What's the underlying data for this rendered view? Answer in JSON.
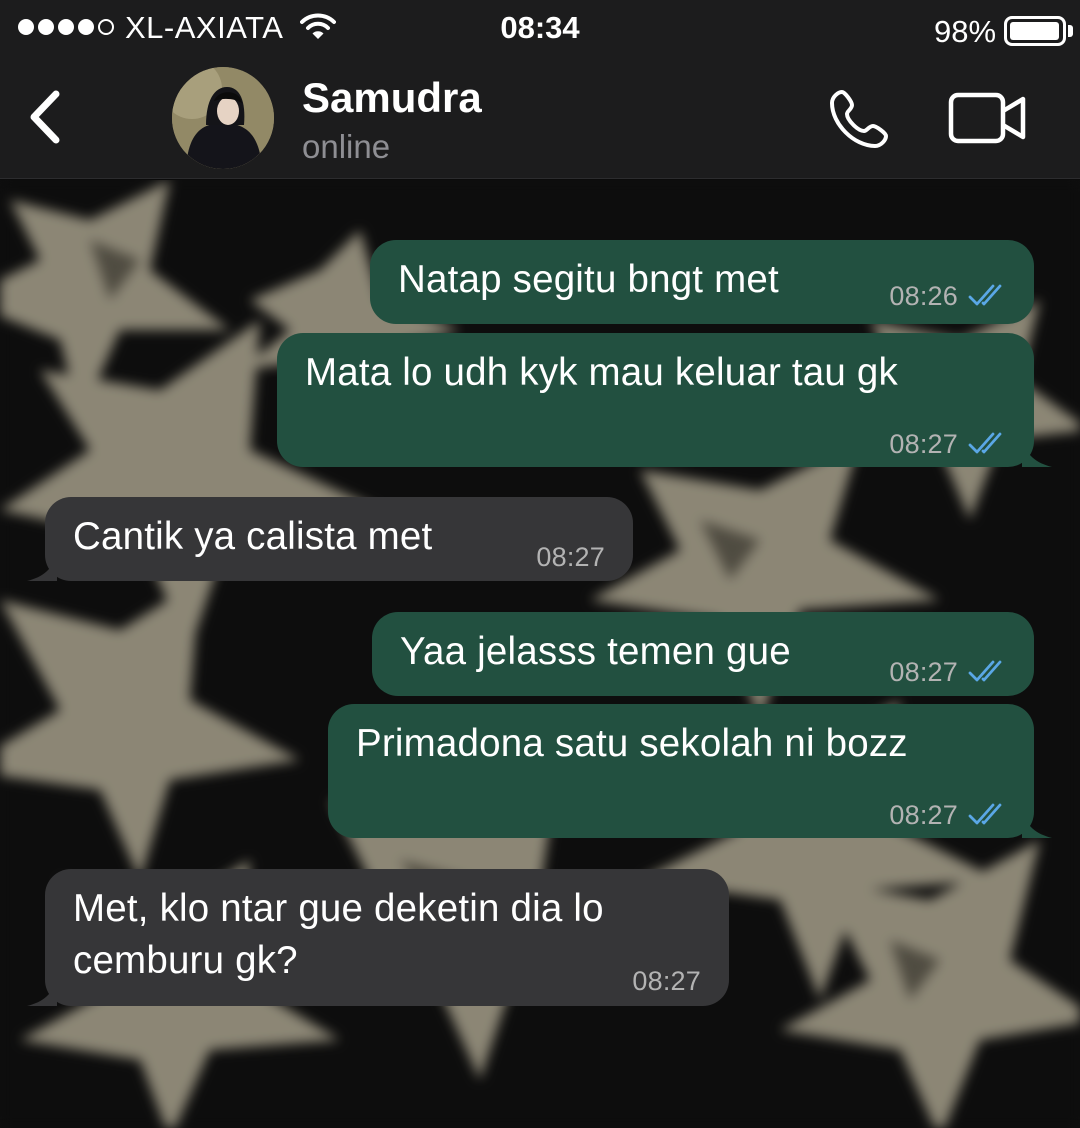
{
  "status_bar": {
    "carrier": "XL-AXIATA",
    "time": "08:34",
    "battery": "98%",
    "battery_level": 0.98,
    "signal_bars": 4,
    "signal_max": 5,
    "icons": [
      "signal-dots-icon",
      "wifi-icon",
      "battery-icon"
    ]
  },
  "header": {
    "contact_name": "Samudra",
    "contact_status": "online",
    "icons": [
      "back-chevron-icon",
      "avatar",
      "phone-icon",
      "video-camera-icon"
    ]
  },
  "messages": [
    {
      "direction": "outgoing",
      "text": "Natap segitu bngt met",
      "time": "08:26",
      "status": "read"
    },
    {
      "direction": "outgoing",
      "text": "Mata lo udh kyk mau keluar tau gk",
      "time": "08:27",
      "status": "read"
    },
    {
      "direction": "incoming",
      "text": "Cantik ya calista met",
      "time": "08:27"
    },
    {
      "direction": "outgoing",
      "text": "Yaa jelasss temen gue",
      "time": "08:27",
      "status": "read"
    },
    {
      "direction": "outgoing",
      "text": "Primadona satu sekolah ni bozz",
      "time": "08:27",
      "status": "read"
    },
    {
      "direction": "incoming",
      "text_lines": [
        "Met, klo ntar gue deketin dia lo",
        "cemburu gk?"
      ],
      "time": "08:27"
    }
  ],
  "colors": {
    "outgoing_bubble": "#225040",
    "incoming_bubble": "#363638",
    "bars_background": "#1c1c1d",
    "read_ticks": "#5aa7e6",
    "timestamp": "#b3b3b3"
  }
}
